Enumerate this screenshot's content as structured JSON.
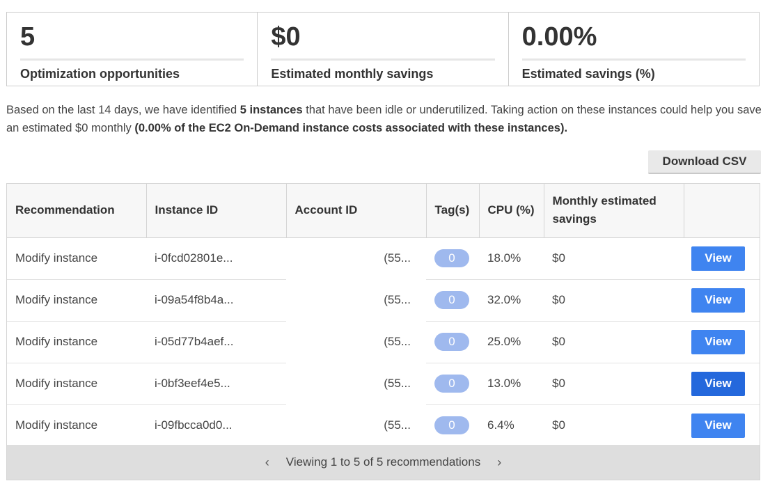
{
  "summary": [
    {
      "value": "5",
      "label": "Optimization opportunities"
    },
    {
      "value": "$0",
      "label": "Estimated monthly savings"
    },
    {
      "value": "0.00%",
      "label": "Estimated savings (%)"
    }
  ],
  "description": {
    "part1": "Based on the last 14 days, we have identified ",
    "bold1": "5 instances",
    "part2": " that have been idle or underutilized. Taking action on these instances could help you save an estimated $0 monthly ",
    "bold2": "(0.00% of the EC2 On-Demand instance costs associated with these instances)."
  },
  "toolbar": {
    "download_label": "Download CSV"
  },
  "table": {
    "columns": [
      "Recommendation",
      "Instance ID",
      "Account ID",
      "Tag(s)",
      "CPU (%)",
      "Monthly estimated savings",
      ""
    ],
    "rows": [
      {
        "recommendation": "Modify instance",
        "instance_id": "i-0fcd02801e...",
        "account_id": "(55...",
        "tags": "0",
        "cpu": "18.0%",
        "savings": "$0",
        "action": "View"
      },
      {
        "recommendation": "Modify instance",
        "instance_id": "i-09a54f8b4a...",
        "account_id": "(55...",
        "tags": "0",
        "cpu": "32.0%",
        "savings": "$0",
        "action": "View"
      },
      {
        "recommendation": "Modify instance",
        "instance_id": "i-05d77b4aef...",
        "account_id": "(55...",
        "tags": "0",
        "cpu": "25.0%",
        "savings": "$0",
        "action": "View"
      },
      {
        "recommendation": "Modify instance",
        "instance_id": "i-0bf3eef4e5...",
        "account_id": "(55...",
        "tags": "0",
        "cpu": "13.0%",
        "savings": "$0",
        "action": "View"
      },
      {
        "recommendation": "Modify instance",
        "instance_id": "i-09fbcca0d0...",
        "account_id": "(55...",
        "tags": "0",
        "cpu": "6.4%",
        "savings": "$0",
        "action": "View"
      }
    ]
  },
  "pagination": {
    "text": "Viewing 1 to 5 of 5 recommendations",
    "prev_icon": "chevron-left-icon",
    "next_icon": "chevron-right-icon"
  },
  "colors": {
    "primary_button": "#3f84f0",
    "primary_button_active": "#2468dc",
    "tag_pill": "#9fb9ee",
    "pager_background": "#dedede"
  }
}
